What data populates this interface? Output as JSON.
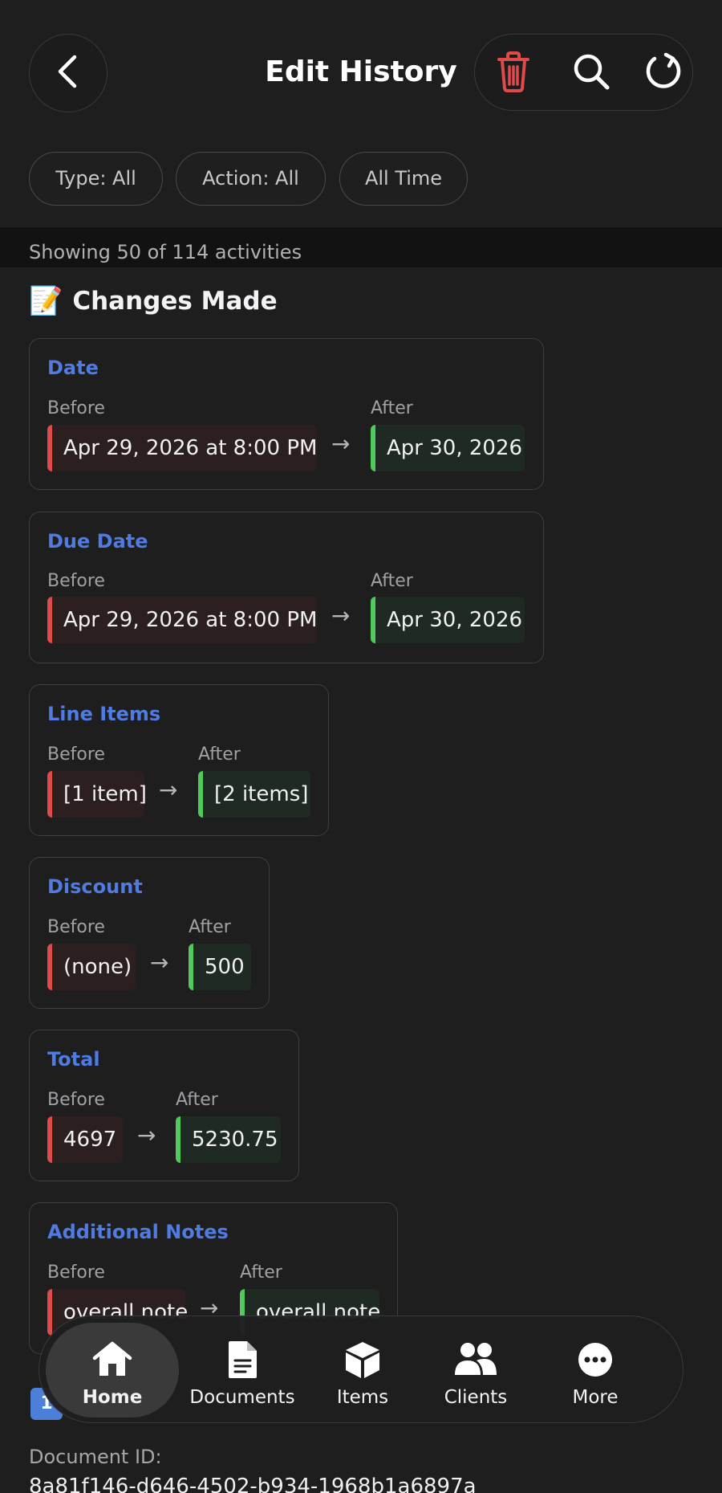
{
  "header": {
    "title": "Edit History",
    "back_icon": "chevron-left-icon",
    "actions": [
      {
        "name": "delete",
        "icon": "trash-icon",
        "color": "#e04a4a"
      },
      {
        "name": "search",
        "icon": "search-icon",
        "color": "#ffffff"
      },
      {
        "name": "refresh",
        "icon": "refresh-icon",
        "color": "#ffffff"
      }
    ]
  },
  "filters": {
    "type": "Type: All",
    "action": "Action: All",
    "time": "All Time"
  },
  "count_text": "Showing 50 of 114 activities",
  "section": {
    "emoji": "📝",
    "title": "Changes Made"
  },
  "labels": {
    "before": "Before",
    "after": "After"
  },
  "changes": [
    {
      "field": "Date",
      "before": "Apr 29, 2026 at 8:00 PM",
      "after": "Apr 30, 2026"
    },
    {
      "field": "Due Date",
      "before": "Apr 29, 2026 at 8:00 PM",
      "after": "Apr 30, 2026"
    },
    {
      "field": "Line Items",
      "before": "[1 item]",
      "after": "[2 items]"
    },
    {
      "field": "Discount",
      "before": "(none)",
      "after": "500"
    },
    {
      "field": "Total",
      "before": "4697",
      "after": "5230.75"
    },
    {
      "field": "Additional Notes",
      "before": "overall note",
      "after": "overall note"
    }
  ],
  "badge": "1",
  "document": {
    "label": "Document ID:",
    "id": "8a81f146-d646-4502-b934-1968b1a6897a"
  },
  "tabbar": {
    "active": "Home",
    "tabs": [
      {
        "label": "Home",
        "icon": "home-icon"
      },
      {
        "label": "Documents",
        "icon": "document-icon"
      },
      {
        "label": "Items",
        "icon": "box-icon"
      },
      {
        "label": "Clients",
        "icon": "people-icon"
      },
      {
        "label": "More",
        "icon": "more-icon"
      }
    ]
  },
  "colors": {
    "background": "#1e1e1f",
    "accent_blue": "#4f7be3",
    "before_red": "#e04a4a",
    "after_green": "#4fca5b"
  }
}
